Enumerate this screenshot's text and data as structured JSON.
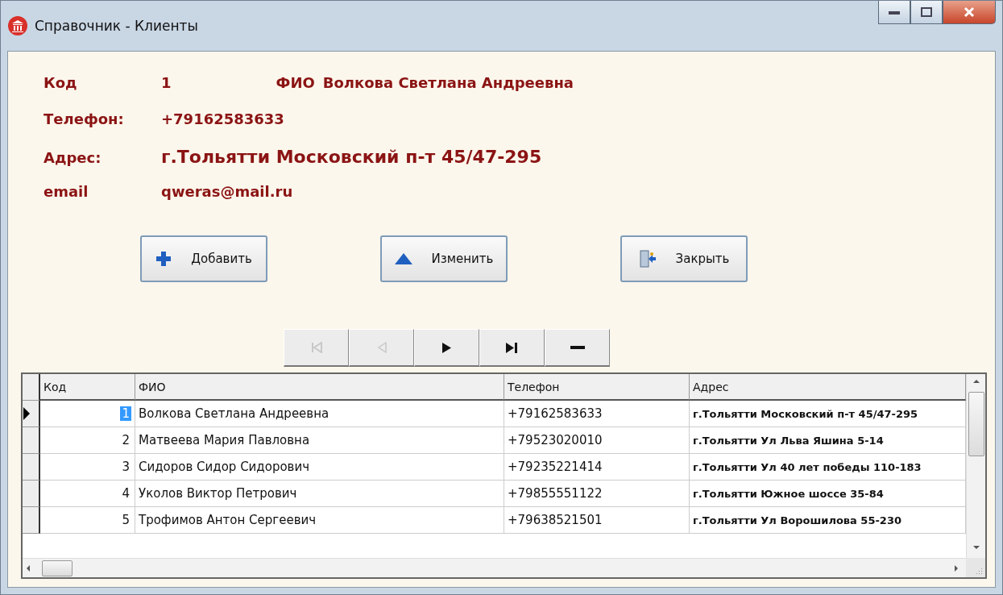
{
  "window": {
    "title": "Справочник - Клиенты"
  },
  "record_lines": [
    {
      "fields": [
        {
          "label": "Код",
          "value": "1"
        },
        {
          "label": "ФИО",
          "value": "Волкова Светлана Андреевна"
        }
      ]
    },
    {
      "fields": [
        {
          "label": "Телефон:",
          "value": "+79162583633"
        }
      ]
    },
    {
      "fields": [
        {
          "label": "Адрес:",
          "value": "г.Тольятти Московский п-т 45/47-295"
        }
      ]
    },
    {
      "fields": [
        {
          "label": "email",
          "value": "qweras@mail.ru"
        }
      ]
    }
  ],
  "buttons": [
    {
      "kind": "add",
      "label": "Добавить"
    },
    {
      "kind": "edit",
      "label": "Изменить"
    },
    {
      "kind": "close",
      "label": "Закрыть"
    }
  ],
  "navigator": [
    {
      "kind": "first",
      "disabled": true
    },
    {
      "kind": "prev",
      "disabled": true
    },
    {
      "kind": "next",
      "disabled": false
    },
    {
      "kind": "last",
      "disabled": false
    },
    {
      "kind": "delete",
      "disabled": false
    }
  ],
  "table": {
    "columns": [
      "Код",
      "ФИО",
      "Телефон",
      "Адрес"
    ],
    "rows": [
      {
        "selected": true,
        "cells": [
          "1",
          "Волкова Светлана Андреевна",
          "+79162583633",
          "г.Тольятти Московский п-т 45/47-295"
        ]
      },
      {
        "selected": false,
        "cells": [
          "2",
          "Матвеева Мария Павловна",
          "+79523020010",
          "г.Тольятти Ул Льва Яшина 5-14"
        ]
      },
      {
        "selected": false,
        "cells": [
          "3",
          "Сидоров Сидор Сидорович",
          "+79235221414",
          "г.Тольятти Ул 40 лет победы 110-183"
        ]
      },
      {
        "selected": false,
        "cells": [
          "4",
          "Уколов Виктор Петрович",
          "+79855551122",
          "г.Тольятти Южное шоссе 35-84"
        ]
      },
      {
        "selected": false,
        "cells": [
          "5",
          "Трофимов Антон Сергеевич",
          "+79638521501",
          "г.Тольятти Ул Ворошилова 55-230"
        ]
      }
    ]
  }
}
